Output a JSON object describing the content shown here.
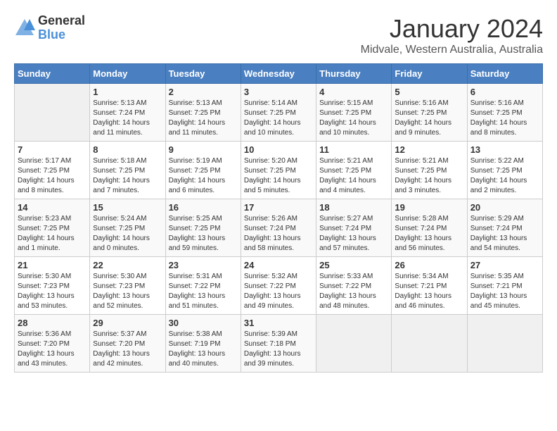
{
  "logo": {
    "general": "General",
    "blue": "Blue"
  },
  "title": "January 2024",
  "location": "Midvale, Western Australia, Australia",
  "weekdays": [
    "Sunday",
    "Monday",
    "Tuesday",
    "Wednesday",
    "Thursday",
    "Friday",
    "Saturday"
  ],
  "weeks": [
    [
      {
        "day": "",
        "info": ""
      },
      {
        "day": "1",
        "info": "Sunrise: 5:13 AM\nSunset: 7:24 PM\nDaylight: 14 hours\nand 11 minutes."
      },
      {
        "day": "2",
        "info": "Sunrise: 5:13 AM\nSunset: 7:25 PM\nDaylight: 14 hours\nand 11 minutes."
      },
      {
        "day": "3",
        "info": "Sunrise: 5:14 AM\nSunset: 7:25 PM\nDaylight: 14 hours\nand 10 minutes."
      },
      {
        "day": "4",
        "info": "Sunrise: 5:15 AM\nSunset: 7:25 PM\nDaylight: 14 hours\nand 10 minutes."
      },
      {
        "day": "5",
        "info": "Sunrise: 5:16 AM\nSunset: 7:25 PM\nDaylight: 14 hours\nand 9 minutes."
      },
      {
        "day": "6",
        "info": "Sunrise: 5:16 AM\nSunset: 7:25 PM\nDaylight: 14 hours\nand 8 minutes."
      }
    ],
    [
      {
        "day": "7",
        "info": "Sunrise: 5:17 AM\nSunset: 7:25 PM\nDaylight: 14 hours\nand 8 minutes."
      },
      {
        "day": "8",
        "info": "Sunrise: 5:18 AM\nSunset: 7:25 PM\nDaylight: 14 hours\nand 7 minutes."
      },
      {
        "day": "9",
        "info": "Sunrise: 5:19 AM\nSunset: 7:25 PM\nDaylight: 14 hours\nand 6 minutes."
      },
      {
        "day": "10",
        "info": "Sunrise: 5:20 AM\nSunset: 7:25 PM\nDaylight: 14 hours\nand 5 minutes."
      },
      {
        "day": "11",
        "info": "Sunrise: 5:21 AM\nSunset: 7:25 PM\nDaylight: 14 hours\nand 4 minutes."
      },
      {
        "day": "12",
        "info": "Sunrise: 5:21 AM\nSunset: 7:25 PM\nDaylight: 14 hours\nand 3 minutes."
      },
      {
        "day": "13",
        "info": "Sunrise: 5:22 AM\nSunset: 7:25 PM\nDaylight: 14 hours\nand 2 minutes."
      }
    ],
    [
      {
        "day": "14",
        "info": "Sunrise: 5:23 AM\nSunset: 7:25 PM\nDaylight: 14 hours\nand 1 minute."
      },
      {
        "day": "15",
        "info": "Sunrise: 5:24 AM\nSunset: 7:25 PM\nDaylight: 14 hours\nand 0 minutes."
      },
      {
        "day": "16",
        "info": "Sunrise: 5:25 AM\nSunset: 7:25 PM\nDaylight: 13 hours\nand 59 minutes."
      },
      {
        "day": "17",
        "info": "Sunrise: 5:26 AM\nSunset: 7:24 PM\nDaylight: 13 hours\nand 58 minutes."
      },
      {
        "day": "18",
        "info": "Sunrise: 5:27 AM\nSunset: 7:24 PM\nDaylight: 13 hours\nand 57 minutes."
      },
      {
        "day": "19",
        "info": "Sunrise: 5:28 AM\nSunset: 7:24 PM\nDaylight: 13 hours\nand 56 minutes."
      },
      {
        "day": "20",
        "info": "Sunrise: 5:29 AM\nSunset: 7:24 PM\nDaylight: 13 hours\nand 54 minutes."
      }
    ],
    [
      {
        "day": "21",
        "info": "Sunrise: 5:30 AM\nSunset: 7:23 PM\nDaylight: 13 hours\nand 53 minutes."
      },
      {
        "day": "22",
        "info": "Sunrise: 5:30 AM\nSunset: 7:23 PM\nDaylight: 13 hours\nand 52 minutes."
      },
      {
        "day": "23",
        "info": "Sunrise: 5:31 AM\nSunset: 7:22 PM\nDaylight: 13 hours\nand 51 minutes."
      },
      {
        "day": "24",
        "info": "Sunrise: 5:32 AM\nSunset: 7:22 PM\nDaylight: 13 hours\nand 49 minutes."
      },
      {
        "day": "25",
        "info": "Sunrise: 5:33 AM\nSunset: 7:22 PM\nDaylight: 13 hours\nand 48 minutes."
      },
      {
        "day": "26",
        "info": "Sunrise: 5:34 AM\nSunset: 7:21 PM\nDaylight: 13 hours\nand 46 minutes."
      },
      {
        "day": "27",
        "info": "Sunrise: 5:35 AM\nSunset: 7:21 PM\nDaylight: 13 hours\nand 45 minutes."
      }
    ],
    [
      {
        "day": "28",
        "info": "Sunrise: 5:36 AM\nSunset: 7:20 PM\nDaylight: 13 hours\nand 43 minutes."
      },
      {
        "day": "29",
        "info": "Sunrise: 5:37 AM\nSunset: 7:20 PM\nDaylight: 13 hours\nand 42 minutes."
      },
      {
        "day": "30",
        "info": "Sunrise: 5:38 AM\nSunset: 7:19 PM\nDaylight: 13 hours\nand 40 minutes."
      },
      {
        "day": "31",
        "info": "Sunrise: 5:39 AM\nSunset: 7:18 PM\nDaylight: 13 hours\nand 39 minutes."
      },
      {
        "day": "",
        "info": ""
      },
      {
        "day": "",
        "info": ""
      },
      {
        "day": "",
        "info": ""
      }
    ]
  ]
}
